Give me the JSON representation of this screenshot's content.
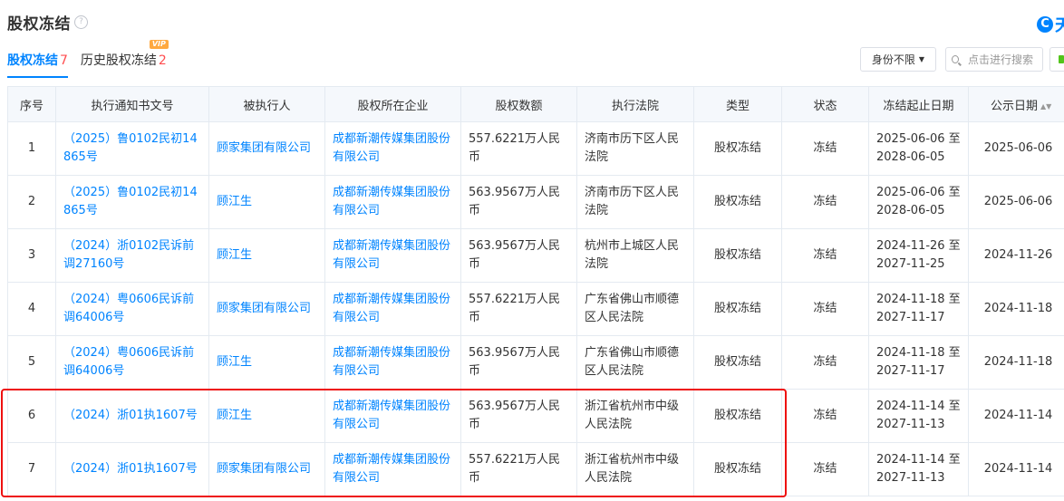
{
  "page": {
    "title": "股权冻结",
    "help_icon": "?",
    "logo_mark": "C",
    "logo_text": "天"
  },
  "tabs": [
    {
      "label": "股权冻结",
      "count": "7",
      "active": true
    },
    {
      "label": "历史股权冻结",
      "count": "2",
      "badge": "VIP"
    }
  ],
  "toolbar": {
    "filter_label": "身份不限",
    "filter_caret": "▼",
    "search_placeholder": "点击进行搜索"
  },
  "table": {
    "headers": [
      "序号",
      "执行通知书文号",
      "被执行人",
      "股权所在企业",
      "股权数额",
      "执行法院",
      "类型",
      "状态",
      "冻结起止日期",
      "公示日期"
    ],
    "sort_icon": "▲▼",
    "rows": [
      {
        "no": "1",
        "doc": "（2025）鲁0102民初14865号",
        "person": "顾家集团有限公司",
        "company": "成都新潮传媒集团股份有限公司",
        "amount": "557.6221万人民币",
        "court": "济南市历下区人民法院",
        "type": "股权冻结",
        "status": "冻结",
        "period": "2025-06-06 至 2028-06-05",
        "date": "2025-06-06"
      },
      {
        "no": "2",
        "doc": "（2025）鲁0102民初14865号",
        "person": "顾江生",
        "company": "成都新潮传媒集团股份有限公司",
        "amount": "563.9567万人民币",
        "court": "济南市历下区人民法院",
        "type": "股权冻结",
        "status": "冻结",
        "period": "2025-06-06 至 2028-06-05",
        "date": "2025-06-06"
      },
      {
        "no": "3",
        "doc": "（2024）浙0102民诉前调27160号",
        "person": "顾江生",
        "company": "成都新潮传媒集团股份有限公司",
        "amount": "563.9567万人民币",
        "court": "杭州市上城区人民法院",
        "type": "股权冻结",
        "status": "冻结",
        "period": "2024-11-26 至 2027-11-25",
        "date": "2024-11-26"
      },
      {
        "no": "4",
        "doc": "（2024）粤0606民诉前调64006号",
        "person": "顾家集团有限公司",
        "company": "成都新潮传媒集团股份有限公司",
        "amount": "557.6221万人民币",
        "court": "广东省佛山市顺德区人民法院",
        "type": "股权冻结",
        "status": "冻结",
        "period": "2024-11-18 至 2027-11-17",
        "date": "2024-11-18"
      },
      {
        "no": "5",
        "doc": "（2024）粤0606民诉前调64006号",
        "person": "顾江生",
        "company": "成都新潮传媒集团股份有限公司",
        "amount": "563.9567万人民币",
        "court": "广东省佛山市顺德区人民法院",
        "type": "股权冻结",
        "status": "冻结",
        "period": "2024-11-18 至 2027-11-17",
        "date": "2024-11-18"
      },
      {
        "no": "6",
        "doc": "（2024）浙01执1607号",
        "person": "顾江生",
        "company": "成都新潮传媒集团股份有限公司",
        "amount": "563.9567万人民币",
        "court": "浙江省杭州市中级人民法院",
        "type": "股权冻结",
        "status": "冻结",
        "period": "2024-11-14 至 2027-11-13",
        "date": "2024-11-14"
      },
      {
        "no": "7",
        "doc": "（2024）浙01执1607号",
        "person": "顾家集团有限公司",
        "company": "成都新潮传媒集团股份有限公司",
        "amount": "557.6221万人民币",
        "court": "浙江省杭州市中级人民法院",
        "type": "股权冻结",
        "status": "冻结",
        "period": "2024-11-14 至 2027-11-13",
        "date": "2024-11-14"
      }
    ]
  },
  "colors": {
    "accent": "#0084ff",
    "count": "#ff4d4f",
    "highlight": "#ee1010",
    "header_bg": "#f5f8fc"
  }
}
